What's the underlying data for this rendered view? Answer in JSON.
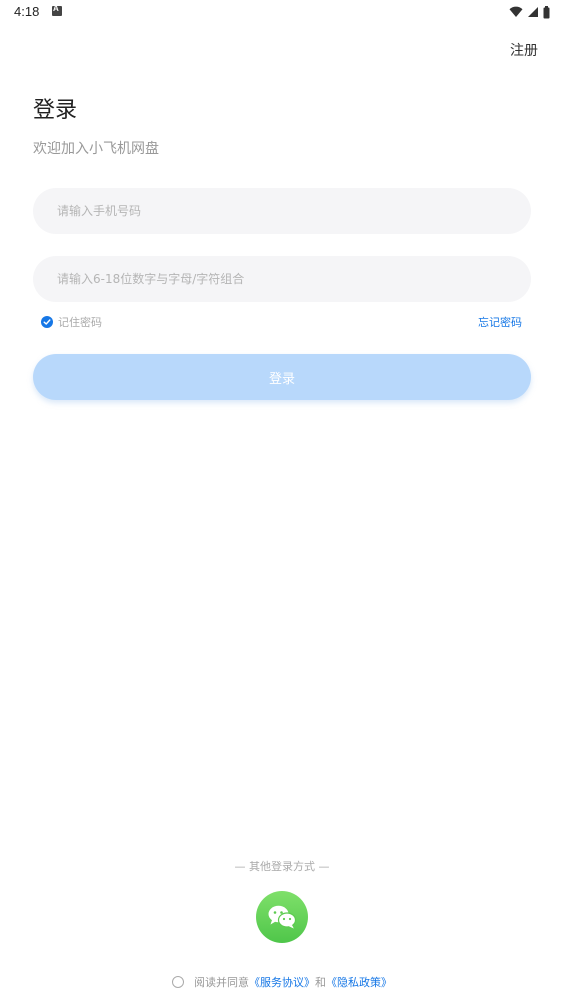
{
  "status_bar": {
    "time": "4:18"
  },
  "header": {
    "register_label": "注册"
  },
  "main": {
    "title": "登录",
    "subtitle": "欢迎加入小飞机网盘",
    "phone_placeholder": "请输入手机号码",
    "password_placeholder": "请输入6-18位数字与字母/字符组合",
    "remember_label": "记住密码",
    "remember_checked": true,
    "forgot_label": "忘记密码",
    "login_button_label": "登录"
  },
  "footer": {
    "other_login_label": "— 其他登录方式 —",
    "agreement_prefix": "阅读并同意",
    "service_link": "《服务协议》",
    "conjunction": "和",
    "privacy_link": "《隐私政策》"
  },
  "colors": {
    "accent": "#1677e6",
    "login_button": "#b8d8fb",
    "input_bg": "#f5f5f7",
    "wechat_green": "#5ccb4f"
  },
  "icons": {
    "status": [
      "a-notification-icon",
      "wifi-icon",
      "signal-icon",
      "battery-icon"
    ],
    "check": "check-icon",
    "wechat": "wechat-icon"
  }
}
